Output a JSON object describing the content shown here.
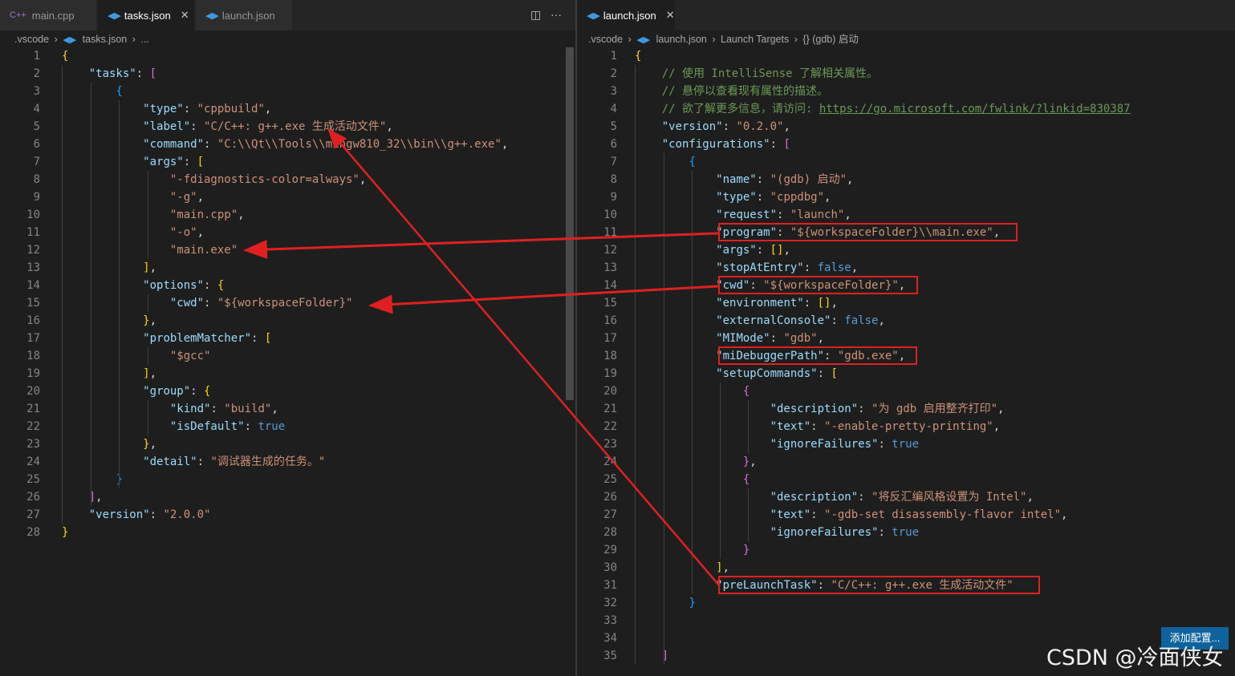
{
  "tabs_left": [
    {
      "label": "main.cpp",
      "icon": "cpp-icon"
    },
    {
      "label": "tasks.json",
      "icon": "vscode-icon",
      "active": true
    },
    {
      "label": "launch.json",
      "icon": "vscode-icon"
    }
  ],
  "tabs_right": [
    {
      "label": "launch.json",
      "icon": "vscode-icon",
      "active": true
    }
  ],
  "breadcrumb_left": [
    ".vscode",
    "tasks.json",
    "..."
  ],
  "breadcrumb_right": [
    ".vscode",
    "launch.json",
    "Launch Targets",
    "{} (gdb) 启动"
  ],
  "left_lines": [
    [
      [
        "b1",
        "{"
      ]
    ],
    [
      [
        "p",
        "    "
      ],
      [
        "k",
        "\"tasks\""
      ],
      [
        "p",
        ": "
      ],
      [
        "b2",
        "["
      ]
    ],
    [
      [
        "p",
        "        "
      ],
      [
        "b3",
        "{"
      ]
    ],
    [
      [
        "p",
        "            "
      ],
      [
        "k",
        "\"type\""
      ],
      [
        "p",
        ": "
      ],
      [
        "s",
        "\"cppbuild\""
      ],
      [
        "p",
        ","
      ]
    ],
    [
      [
        "p",
        "            "
      ],
      [
        "k",
        "\"label\""
      ],
      [
        "p",
        ": "
      ],
      [
        "s",
        "\"C/C++: g++.exe 生成活动文件\""
      ],
      [
        "p",
        ","
      ]
    ],
    [
      [
        "p",
        "            "
      ],
      [
        "k",
        "\"command\""
      ],
      [
        "p",
        ": "
      ],
      [
        "s",
        "\"C:\\\\Qt\\\\Tools\\\\mingw810_32\\\\bin\\\\g++.exe\""
      ],
      [
        "p",
        ","
      ]
    ],
    [
      [
        "p",
        "            "
      ],
      [
        "k",
        "\"args\""
      ],
      [
        "p",
        ": "
      ],
      [
        "b1",
        "["
      ]
    ],
    [
      [
        "p",
        "                "
      ],
      [
        "s",
        "\"-fdiagnostics-color=always\""
      ],
      [
        "p",
        ","
      ]
    ],
    [
      [
        "p",
        "                "
      ],
      [
        "s",
        "\"-g\""
      ],
      [
        "p",
        ","
      ]
    ],
    [
      [
        "p",
        "                "
      ],
      [
        "s",
        "\"main.cpp\""
      ],
      [
        "p",
        ","
      ]
    ],
    [
      [
        "p",
        "                "
      ],
      [
        "s",
        "\"-o\""
      ],
      [
        "p",
        ","
      ]
    ],
    [
      [
        "p",
        "                "
      ],
      [
        "s",
        "\"main.exe\""
      ]
    ],
    [
      [
        "p",
        "            "
      ],
      [
        "b1",
        "]"
      ],
      [
        "p",
        ","
      ]
    ],
    [
      [
        "p",
        "            "
      ],
      [
        "k",
        "\"options\""
      ],
      [
        "p",
        ": "
      ],
      [
        "b1",
        "{"
      ]
    ],
    [
      [
        "p",
        "                "
      ],
      [
        "k",
        "\"cwd\""
      ],
      [
        "p",
        ": "
      ],
      [
        "s",
        "\"${workspaceFolder}\""
      ]
    ],
    [
      [
        "p",
        "            "
      ],
      [
        "b1",
        "}"
      ],
      [
        "p",
        ","
      ]
    ],
    [
      [
        "p",
        "            "
      ],
      [
        "k",
        "\"problemMatcher\""
      ],
      [
        "p",
        ": "
      ],
      [
        "b1",
        "["
      ]
    ],
    [
      [
        "p",
        "                "
      ],
      [
        "s",
        "\"$gcc\""
      ]
    ],
    [
      [
        "p",
        "            "
      ],
      [
        "b1",
        "]"
      ],
      [
        "p",
        ","
      ]
    ],
    [
      [
        "p",
        "            "
      ],
      [
        "k",
        "\"group\""
      ],
      [
        "p",
        ": "
      ],
      [
        "b1",
        "{"
      ]
    ],
    [
      [
        "p",
        "                "
      ],
      [
        "k",
        "\"kind\""
      ],
      [
        "p",
        ": "
      ],
      [
        "s",
        "\"build\""
      ],
      [
        "p",
        ","
      ]
    ],
    [
      [
        "p",
        "                "
      ],
      [
        "k",
        "\"isDefault\""
      ],
      [
        "p",
        ": "
      ],
      [
        "kw",
        "true"
      ]
    ],
    [
      [
        "p",
        "            "
      ],
      [
        "b1",
        "}"
      ],
      [
        "p",
        ","
      ]
    ],
    [
      [
        "p",
        "            "
      ],
      [
        "k",
        "\"detail\""
      ],
      [
        "p",
        ": "
      ],
      [
        "s",
        "\"调试器生成的任务。\""
      ]
    ],
    [
      [
        "p",
        "        "
      ],
      [
        "b3",
        "}"
      ]
    ],
    [
      [
        "p",
        "    "
      ],
      [
        "b2",
        "]"
      ],
      [
        "p",
        ","
      ]
    ],
    [
      [
        "p",
        "    "
      ],
      [
        "k",
        "\"version\""
      ],
      [
        "p",
        ": "
      ],
      [
        "s",
        "\"2.0.0\""
      ]
    ],
    [
      [
        "b1",
        "}"
      ]
    ]
  ],
  "right_lines": [
    [
      [
        "b1",
        "{"
      ]
    ],
    [
      [
        "p",
        "    "
      ],
      [
        "c",
        "// 使用 IntelliSense 了解相关属性。"
      ]
    ],
    [
      [
        "p",
        "    "
      ],
      [
        "c",
        "// 悬停以查看现有属性的描述。"
      ]
    ],
    [
      [
        "p",
        "    "
      ],
      [
        "c",
        "// 欲了解更多信息，请访问: "
      ],
      [
        "u",
        "https://go.microsoft.com/fwlink/?linkid=830387"
      ]
    ],
    [
      [
        "p",
        "    "
      ],
      [
        "k",
        "\"version\""
      ],
      [
        "p",
        ": "
      ],
      [
        "s",
        "\"0.2.0\""
      ],
      [
        "p",
        ","
      ]
    ],
    [
      [
        "p",
        "    "
      ],
      [
        "k",
        "\"configurations\""
      ],
      [
        "p",
        ": "
      ],
      [
        "b2",
        "["
      ]
    ],
    [
      [
        "p",
        "        "
      ],
      [
        "b3",
        "{"
      ]
    ],
    [
      [
        "p",
        "            "
      ],
      [
        "k",
        "\"name\""
      ],
      [
        "p",
        ": "
      ],
      [
        "s",
        "\"(gdb) 启动\""
      ],
      [
        "p",
        ","
      ]
    ],
    [
      [
        "p",
        "            "
      ],
      [
        "k",
        "\"type\""
      ],
      [
        "p",
        ": "
      ],
      [
        "s",
        "\"cppdbg\""
      ],
      [
        "p",
        ","
      ]
    ],
    [
      [
        "p",
        "            "
      ],
      [
        "k",
        "\"request\""
      ],
      [
        "p",
        ": "
      ],
      [
        "s",
        "\"launch\""
      ],
      [
        "p",
        ","
      ]
    ],
    [
      [
        "p",
        "            "
      ],
      [
        "k",
        "\"program\""
      ],
      [
        "p",
        ": "
      ],
      [
        "s",
        "\"${workspaceFolder}\\\\main.exe\""
      ],
      [
        "p",
        ","
      ]
    ],
    [
      [
        "p",
        "            "
      ],
      [
        "k",
        "\"args\""
      ],
      [
        "p",
        ": "
      ],
      [
        "b1",
        "[]"
      ],
      [
        "p",
        ","
      ]
    ],
    [
      [
        "p",
        "            "
      ],
      [
        "k",
        "\"stopAtEntry\""
      ],
      [
        "p",
        ": "
      ],
      [
        "kw",
        "false"
      ],
      [
        "p",
        ","
      ]
    ],
    [
      [
        "p",
        "            "
      ],
      [
        "k",
        "\"cwd\""
      ],
      [
        "p",
        ": "
      ],
      [
        "s",
        "\"${workspaceFolder}\""
      ],
      [
        "p",
        ","
      ]
    ],
    [
      [
        "p",
        "            "
      ],
      [
        "k",
        "\"environment\""
      ],
      [
        "p",
        ": "
      ],
      [
        "b1",
        "[]"
      ],
      [
        "p",
        ","
      ]
    ],
    [
      [
        "p",
        "            "
      ],
      [
        "k",
        "\"externalConsole\""
      ],
      [
        "p",
        ": "
      ],
      [
        "kw",
        "false"
      ],
      [
        "p",
        ","
      ]
    ],
    [
      [
        "p",
        "            "
      ],
      [
        "k",
        "\"MIMode\""
      ],
      [
        "p",
        ": "
      ],
      [
        "s",
        "\"gdb\""
      ],
      [
        "p",
        ","
      ]
    ],
    [
      [
        "p",
        "            "
      ],
      [
        "k",
        "\"miDebuggerPath\""
      ],
      [
        "p",
        ": "
      ],
      [
        "s",
        "\"gdb.exe\""
      ],
      [
        "p",
        ","
      ]
    ],
    [
      [
        "p",
        "            "
      ],
      [
        "k",
        "\"setupCommands\""
      ],
      [
        "p",
        ": "
      ],
      [
        "b1",
        "["
      ]
    ],
    [
      [
        "p",
        "                "
      ],
      [
        "b2",
        "{"
      ]
    ],
    [
      [
        "p",
        "                    "
      ],
      [
        "k",
        "\"description\""
      ],
      [
        "p",
        ": "
      ],
      [
        "s",
        "\"为 gdb 启用整齐打印\""
      ],
      [
        "p",
        ","
      ]
    ],
    [
      [
        "p",
        "                    "
      ],
      [
        "k",
        "\"text\""
      ],
      [
        "p",
        ": "
      ],
      [
        "s",
        "\"-enable-pretty-printing\""
      ],
      [
        "p",
        ","
      ]
    ],
    [
      [
        "p",
        "                    "
      ],
      [
        "k",
        "\"ignoreFailures\""
      ],
      [
        "p",
        ": "
      ],
      [
        "kw",
        "true"
      ]
    ],
    [
      [
        "p",
        "                "
      ],
      [
        "b2",
        "}"
      ],
      [
        "p",
        ","
      ]
    ],
    [
      [
        "p",
        "                "
      ],
      [
        "b2",
        "{"
      ]
    ],
    [
      [
        "p",
        "                    "
      ],
      [
        "k",
        "\"description\""
      ],
      [
        "p",
        ": "
      ],
      [
        "s",
        "\"将反汇编风格设置为 Intel\""
      ],
      [
        "p",
        ","
      ]
    ],
    [
      [
        "p",
        "                    "
      ],
      [
        "k",
        "\"text\""
      ],
      [
        "p",
        ": "
      ],
      [
        "s",
        "\"-gdb-set disassembly-flavor intel\""
      ],
      [
        "p",
        ","
      ]
    ],
    [
      [
        "p",
        "                    "
      ],
      [
        "k",
        "\"ignoreFailures\""
      ],
      [
        "p",
        ": "
      ],
      [
        "kw",
        "true"
      ]
    ],
    [
      [
        "p",
        "                "
      ],
      [
        "b2",
        "}"
      ]
    ],
    [
      [
        "p",
        "            "
      ],
      [
        "b1",
        "]"
      ],
      [
        "p",
        ","
      ]
    ],
    [
      [
        "p",
        "            "
      ],
      [
        "k",
        "\"preLaunchTask\""
      ],
      [
        "p",
        ": "
      ],
      [
        "s",
        "\"C/C++: g++.exe 生成活动文件\""
      ]
    ],
    [
      [
        "p",
        "        "
      ],
      [
        "b3",
        "}"
      ]
    ],
    [
      [
        "p",
        ""
      ]
    ],
    [
      [
        "p",
        ""
      ]
    ],
    [
      [
        "p",
        "    "
      ],
      [
        "b2",
        "]"
      ]
    ]
  ],
  "add_config_label": "添加配置...",
  "watermark": "CSDN @冷面侠女",
  "colors": {
    "annotation": "#e02020",
    "editor_bg": "#1e1e1e"
  }
}
